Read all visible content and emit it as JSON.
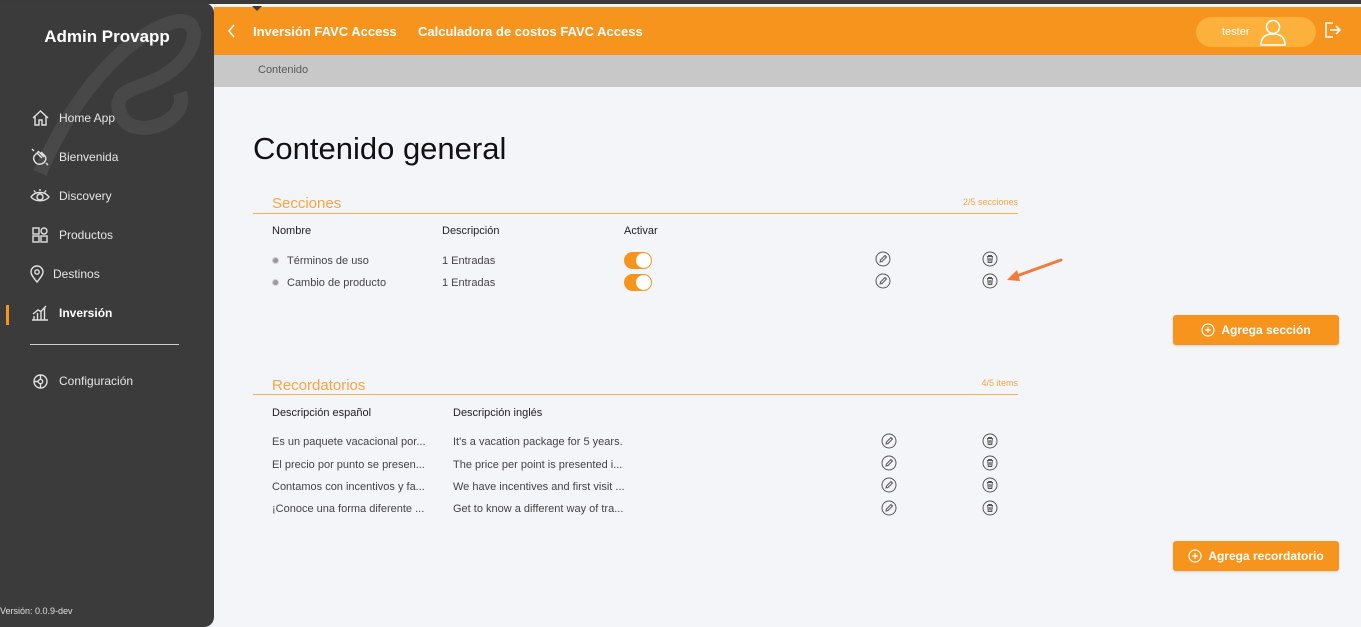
{
  "sidebar": {
    "brand": "Admin Provapp",
    "items": [
      {
        "label": "Home App",
        "icon": "home-icon"
      },
      {
        "label": "Bienvenida",
        "icon": "waving-hand-icon"
      },
      {
        "label": "Discovery",
        "icon": "eye-icon"
      },
      {
        "label": "Productos",
        "icon": "grid-icon"
      },
      {
        "label": "Destinos",
        "icon": "location-pin-icon"
      },
      {
        "label": "Inversión",
        "icon": "bar-chart-icon",
        "active": true
      },
      {
        "label": "Configuración",
        "icon": "gear-icon"
      }
    ],
    "version": "Versión: 0.0.9-dev"
  },
  "header": {
    "crumb1": "Inversión FAVC Access",
    "crumb2": "Calculadora de costos FAVC Access",
    "user": "tester"
  },
  "subbar": {
    "label": "Contenido"
  },
  "page": {
    "title": "Contenido general"
  },
  "secciones": {
    "title": "Secciones",
    "count": "2/5 secciones",
    "columns": [
      "Nombre",
      "Descripción",
      "Activar"
    ],
    "rows": [
      {
        "nombre": "Términos de uso",
        "descripcion": "1 Entradas",
        "activo": true
      },
      {
        "nombre": "Cambio de producto",
        "descripcion": "1 Entradas",
        "activo": true
      }
    ],
    "add_label": "Agrega sección"
  },
  "recordatorios": {
    "title": "Recordatorios",
    "count": "4/5 items",
    "columns": [
      "Descripción español",
      "Descripción inglés"
    ],
    "rows": [
      {
        "es": "Es un paquete vacacional por...",
        "en": "It's a vacation package for 5 years."
      },
      {
        "es": "El precio por punto se presen...",
        "en": "The price per point is presented i..."
      },
      {
        "es": "Contamos con incentivos y fa...",
        "en": "We have incentives and first visit ..."
      },
      {
        "es": "¡Conoce una forma diferente ...",
        "en": "Get to know a different way of tra..."
      }
    ],
    "add_label": "Agrega recordatorio"
  },
  "colors": {
    "accent": "#f7941d",
    "sidebar": "#3b3b3b",
    "background": "#f4f5f9"
  }
}
